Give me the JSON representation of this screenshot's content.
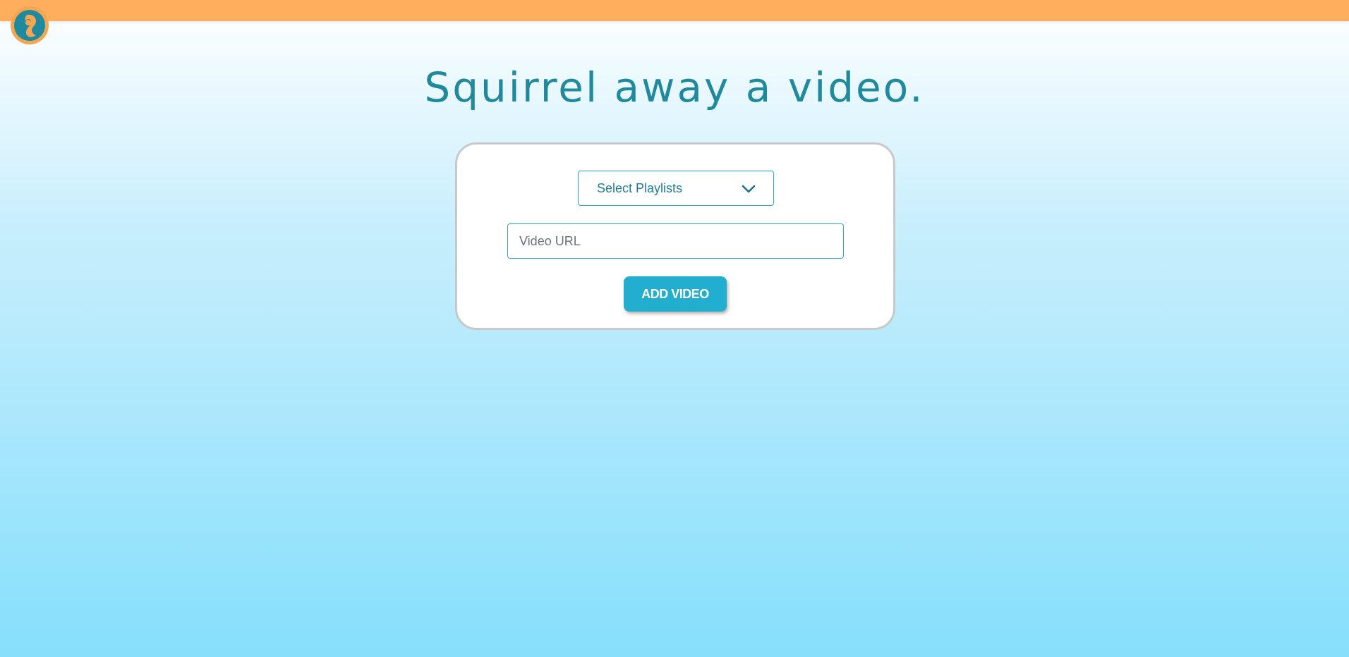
{
  "header": {
    "logo_icon": "squirrel-logo-icon",
    "bar_color": "#ffae5d"
  },
  "main": {
    "title": "Squirrel away a video.",
    "playlist_select": {
      "selected_label": "Select Playlists",
      "icon": "chevron-down-icon"
    },
    "video_url": {
      "value": "",
      "placeholder": "Video URL"
    },
    "add_button_label": "ADD VIDEO"
  },
  "colors": {
    "accent": "#22aecf",
    "title": "#1f8a9e",
    "logo_orange": "#f7a64f",
    "logo_teal": "#1e8aa0"
  }
}
